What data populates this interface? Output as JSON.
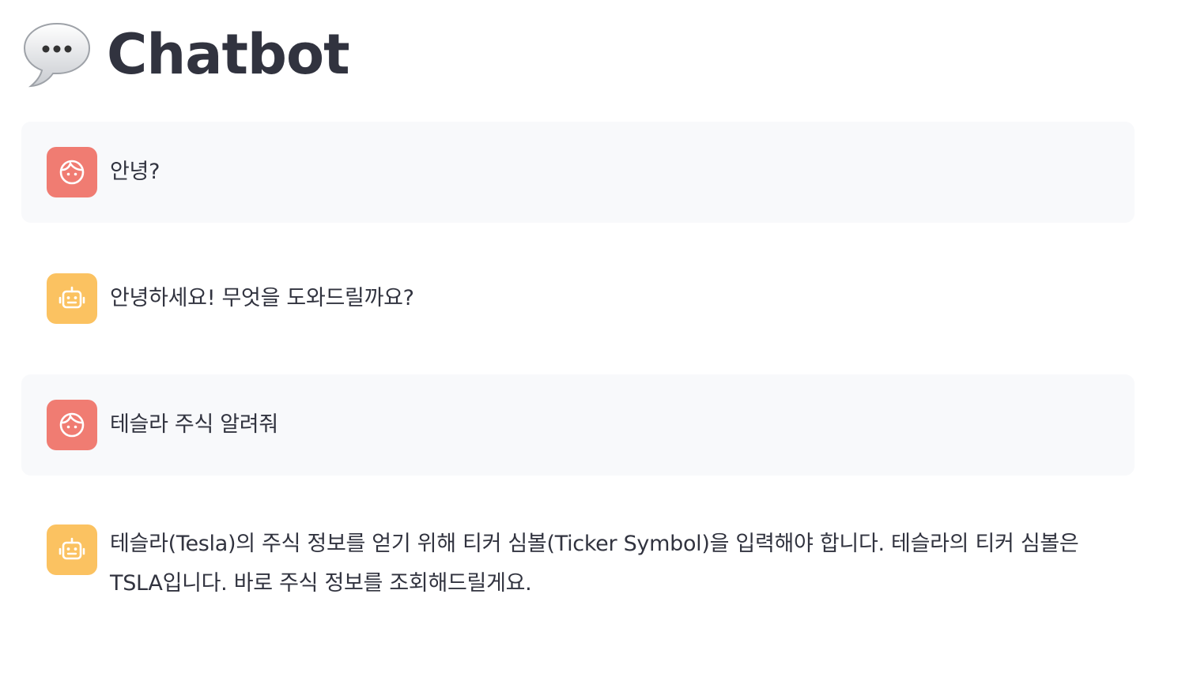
{
  "header": {
    "title": "Chatbot",
    "emoji_icon": "speech-balloon-icon"
  },
  "colors": {
    "user_avatar_bg": "#f07c72",
    "assistant_avatar_bg": "#fbc261",
    "user_message_bg": "#f8f9fb",
    "text": "#31333f"
  },
  "messages": [
    {
      "role": "user",
      "icon": "face-icon",
      "text": "안녕?"
    },
    {
      "role": "assistant",
      "icon": "robot-icon",
      "text": "안녕하세요! 무엇을 도와드릴까요?"
    },
    {
      "role": "user",
      "icon": "face-icon",
      "text": "테슬라 주식 알려줘"
    },
    {
      "role": "assistant",
      "icon": "robot-icon",
      "text": "테슬라(Tesla)의 주식 정보를 얻기 위해 티커 심볼(Ticker Symbol)을 입력해야 합니다. 테슬라의 티커 심볼은 TSLA입니다. 바로 주식 정보를 조회해드릴게요."
    }
  ]
}
